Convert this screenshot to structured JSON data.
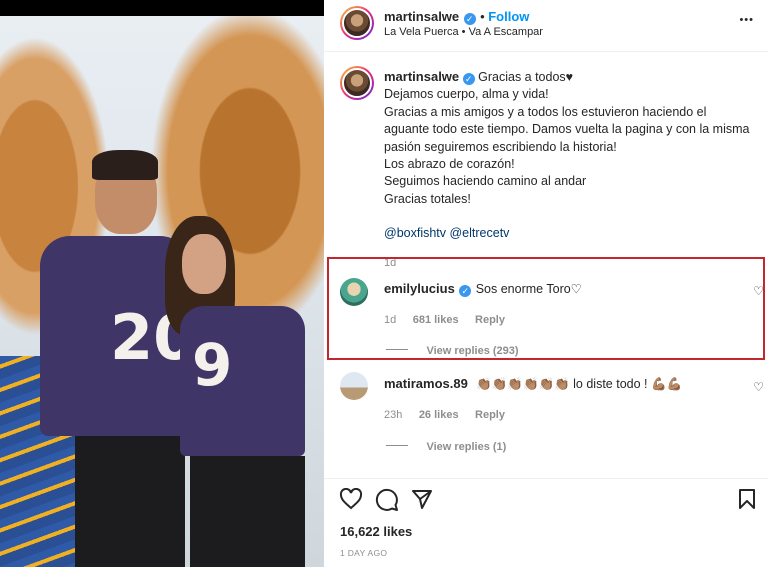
{
  "post": {
    "username": "martinsalwe",
    "follow_label": "Follow",
    "location": "La Vela Puerca • Va A Escampar",
    "more_label": "•••"
  },
  "caption": {
    "username": "martinsalwe",
    "first_line": "Gracias a todos♥",
    "lines": [
      "Dejamos cuerpo, alma y vida!",
      "Gracias a mis amigos y a todos los estuvieron haciendo el aguante todo este tiempo. Damos vuelta la pagina y con la misma pasión seguiremos escribiendo la historia!",
      "Los abrazo de corazón!",
      "Seguimos haciendo camino al andar",
      "Gracias totales!"
    ],
    "mentions": "@boxfishtv @eltrecetv",
    "time": "1d"
  },
  "comments": [
    {
      "username": "emilylucius",
      "text": "Sos enorme Toro♡",
      "time": "1d",
      "likes": "681 likes",
      "reply": "Reply",
      "view_replies": "View replies (293)"
    },
    {
      "username": "matiramos.89",
      "text": "👏🏽👏🏽👏🏽👏🏽👏🏽👏🏽 lo diste todo ! 💪🏽💪🏽",
      "time": "23h",
      "likes": "26 likes",
      "reply": "Reply",
      "view_replies": "View replies (1)"
    }
  ],
  "footer": {
    "likes": "16,622 likes",
    "date": "1 DAY AGO"
  },
  "photo": {
    "jersey_left": "20",
    "jersey_right": "9"
  },
  "colors": {
    "accent": "#3897f0",
    "highlight_border": "#c1272d",
    "jersey": "#3f3566"
  }
}
